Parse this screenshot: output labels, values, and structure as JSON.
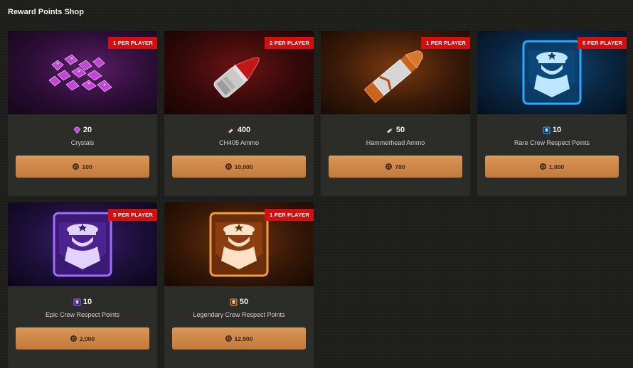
{
  "page": {
    "title": "Reward Points Shop"
  },
  "items": [
    {
      "name": "Crystals",
      "quantity": "20",
      "limit": "1 PER PLAYER",
      "price": "100",
      "image_icon": "crystals-icon",
      "qty_icon": "crystal-icon",
      "theme": "purple"
    },
    {
      "name": "CH405 Ammo",
      "quantity": "400",
      "limit": "2 PER PLAYER",
      "price": "10,000",
      "image_icon": "ammo-icon",
      "qty_icon": "ammo-small-icon",
      "theme": "red"
    },
    {
      "name": "Hammerhead Ammo",
      "quantity": "50",
      "limit": "1 PER PLAYER",
      "price": "700",
      "image_icon": "rocket-ammo-icon",
      "qty_icon": "rocket-small-icon",
      "theme": "orange"
    },
    {
      "name": "Rare Crew Respect Points",
      "quantity": "10",
      "limit": "5 PER PLAYER",
      "price": "1,000",
      "image_icon": "crew-badge-icon",
      "qty_icon": "crew-badge-small-icon",
      "theme": "blue"
    },
    {
      "name": "Epic Crew Respect Points",
      "quantity": "10",
      "limit": "5 PER PLAYER",
      "price": "2,000",
      "image_icon": "crew-badge-icon",
      "qty_icon": "crew-badge-small-icon",
      "theme": "violet"
    },
    {
      "name": "Legendary Crew Respect Points",
      "quantity": "50",
      "limit": "1 PER PLAYER",
      "price": "12,500",
      "image_icon": "crew-badge-icon",
      "qty_icon": "crew-badge-small-icon",
      "theme": "amber"
    }
  ],
  "colors": {
    "background": "#1d1e19",
    "card": "#2c2d29",
    "badge": "#d40f0f",
    "button": "#d08a4a",
    "rare": "#2aa7ff",
    "epic": "#a46bff",
    "legendary": "#f29a4a"
  }
}
